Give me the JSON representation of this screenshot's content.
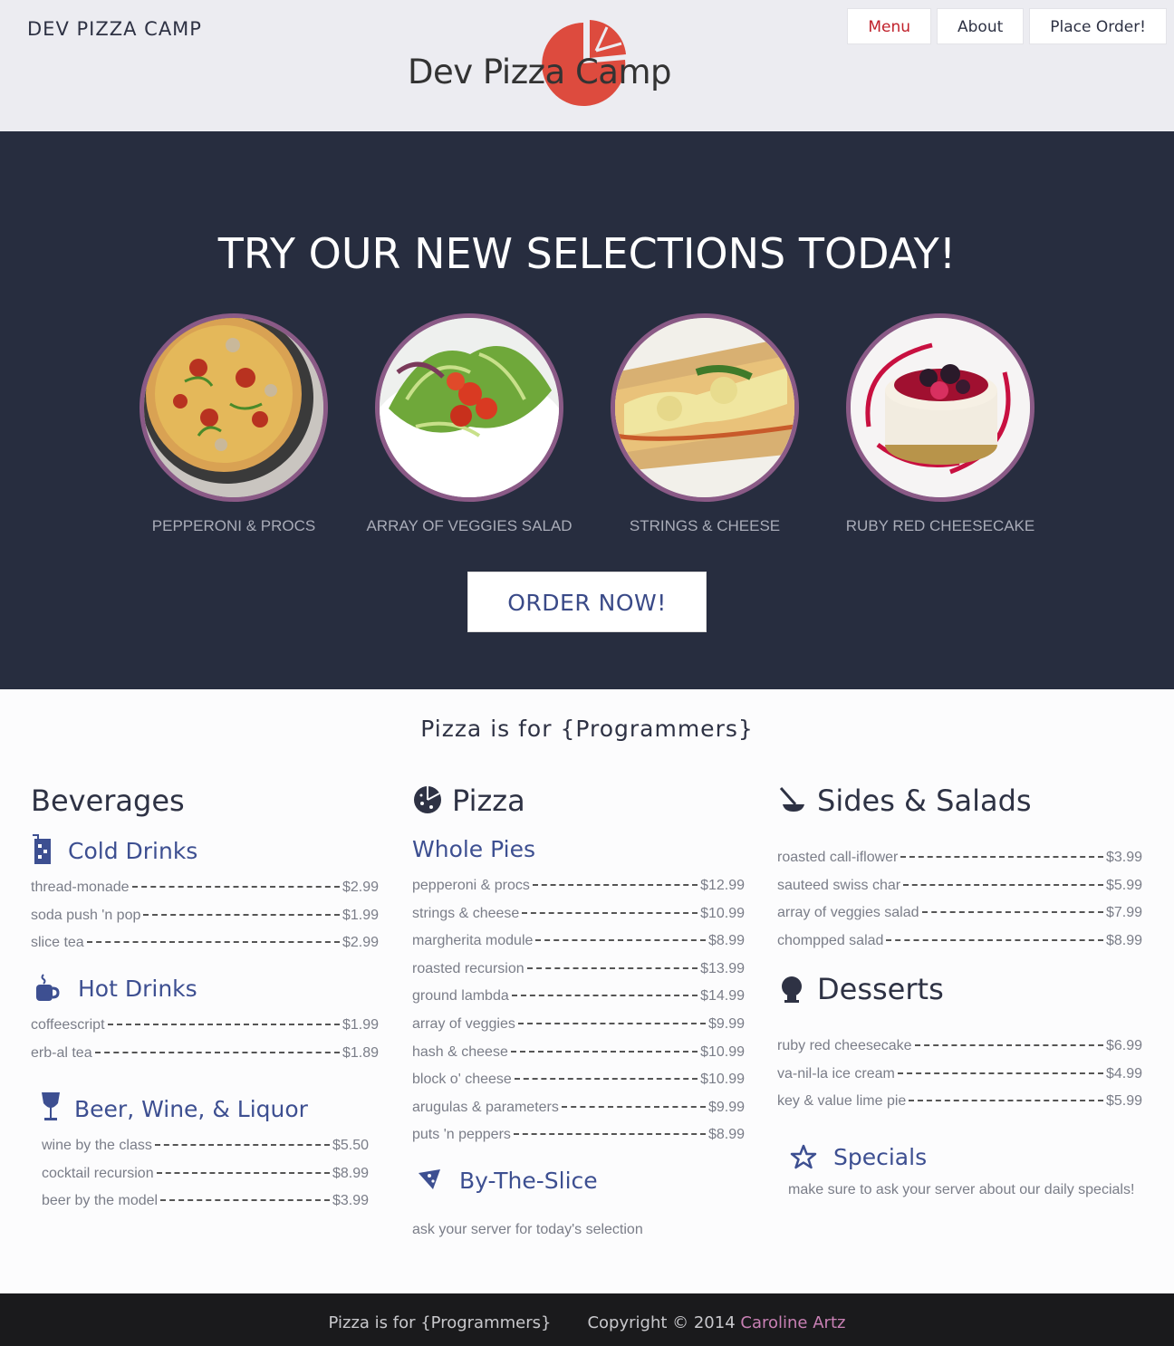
{
  "header": {
    "brand": "DEV PIZZA CAMP",
    "logo_text": "Dev Pizza Camp",
    "nav": [
      "Menu",
      "About",
      "Place Order!"
    ]
  },
  "hero": {
    "title": "TRY OUR NEW SELECTIONS TODAY!",
    "selections": [
      "PEPPERONI & PROCS",
      "ARRAY OF VEGGIES SALAD",
      "STRINGS & CHEESE",
      "RUBY RED CHEESECAKE"
    ],
    "order_button": "ORDER NOW!"
  },
  "menu": {
    "tagline": "Pizza is for {Programmers}",
    "beverages": {
      "title": "Beverages",
      "cold": {
        "title": "Cold Drinks",
        "items": [
          [
            "thread-monade",
            "$2.99"
          ],
          [
            "soda push 'n pop",
            "$1.99"
          ],
          [
            "slice tea",
            "$2.99"
          ]
        ]
      },
      "hot": {
        "title": "Hot Drinks",
        "items": [
          [
            "coffeescript",
            "$1.99"
          ],
          [
            "erb-al tea",
            "$1.89"
          ]
        ]
      },
      "alcohol": {
        "title": "Beer, Wine, & Liquor",
        "items": [
          [
            "wine by the class",
            "$5.50"
          ],
          [
            "cocktail recursion",
            "$8.99"
          ],
          [
            "beer by the model",
            "$3.99"
          ]
        ]
      }
    },
    "pizza": {
      "title": "Pizza",
      "whole": {
        "title": "Whole Pies",
        "items": [
          [
            "pepperoni & procs",
            "$12.99"
          ],
          [
            "strings & cheese",
            "$10.99"
          ],
          [
            "margherita module",
            "$8.99"
          ],
          [
            "roasted recursion",
            "$13.99"
          ],
          [
            "ground lambda",
            "$14.99"
          ],
          [
            "array of veggies",
            "$9.99"
          ],
          [
            "hash & cheese",
            "$10.99"
          ],
          [
            "block o' cheese",
            "$10.99"
          ],
          [
            "arugulas & parameters",
            "$9.99"
          ],
          [
            "puts 'n peppers",
            "$8.99"
          ]
        ]
      },
      "slice": {
        "title": "By-The-Slice",
        "note": "ask your server for today's selection"
      }
    },
    "sides": {
      "title": "Sides & Salads",
      "items": [
        [
          "roasted call-iflower",
          "$3.99"
        ],
        [
          "sauteed swiss char",
          "$5.99"
        ],
        [
          "array of veggies salad",
          "$7.99"
        ],
        [
          "chompped salad",
          "$8.99"
        ]
      ]
    },
    "desserts": {
      "title": "Desserts",
      "items": [
        [
          "ruby red cheesecake",
          "$6.99"
        ],
        [
          "va-nil-la ice cream",
          "$4.99"
        ],
        [
          "key & value lime pie",
          "$5.99"
        ]
      ]
    },
    "specials": {
      "title": "Specials",
      "note": "make sure to ask your server about our daily specials!"
    }
  },
  "footer": {
    "tagline": "Pizza is for {Programmers}",
    "copyright": "Copyright © 2014",
    "author": "Caroline Artz"
  },
  "colors": {
    "hero_bg": "#272d3f",
    "accent_purple": "#8a5a86",
    "logo_red": "#dd4b3e",
    "link_blue": "#3d4f91",
    "nav_active": "#c0202a"
  }
}
